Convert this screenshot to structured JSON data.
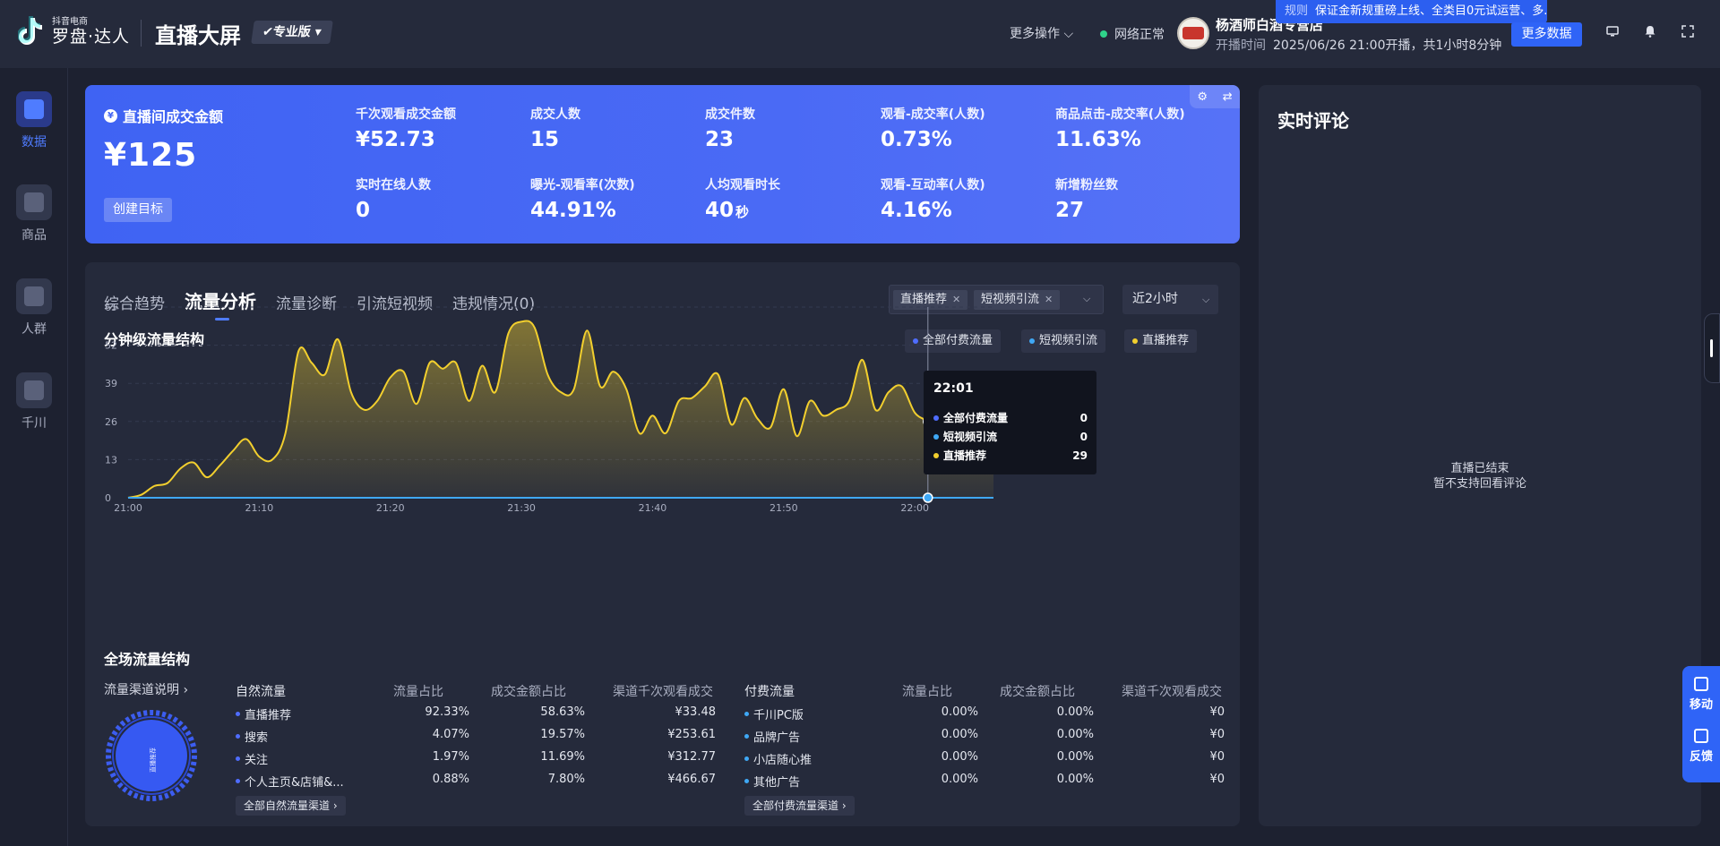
{
  "header": {
    "logo_sub": "抖音电商",
    "logo_main": "罗盘·达人",
    "page_title": "直播大屏",
    "edition": "✔专业版 ▾",
    "more_ops": "更多操作 ⌵",
    "net_status": "网络正常",
    "shop_name": "杨酒师白酒专营店",
    "live_time_label": "开播时间",
    "live_time_value": "2025/06/26 21:00开播，共1小时8分钟",
    "notice_tag": "规则",
    "notice_text": "保证金新规重磅上线、全类目0元试运营、多...",
    "more_data": "更多数据"
  },
  "nav": [
    {
      "label": "数据",
      "active": true
    },
    {
      "label": "商品",
      "active": false
    },
    {
      "label": "人群",
      "active": false
    },
    {
      "label": "千川",
      "active": false
    }
  ],
  "kpi": {
    "main_label": "直播间成交金额",
    "main_value": "¥125",
    "goal_button": "创建目标",
    "cells": [
      {
        "label": "千次观看成交金额",
        "value": "¥52.73",
        "unit": ""
      },
      {
        "label": "成交人数",
        "value": "15",
        "unit": ""
      },
      {
        "label": "成交件数",
        "value": "23",
        "unit": ""
      },
      {
        "label": "观看-成交率(人数)",
        "value": "0.73%",
        "unit": ""
      },
      {
        "label": "商品点击-成交率(人数)",
        "value": "11.63%",
        "unit": ""
      },
      {
        "label": "实时在线人数",
        "value": "0",
        "unit": ""
      },
      {
        "label": "曝光-观看率(次数)",
        "value": "44.91%",
        "unit": ""
      },
      {
        "label": "人均观看时长",
        "value": "40",
        "unit": "秒"
      },
      {
        "label": "观看-互动率(人数)",
        "value": "4.16%",
        "unit": ""
      },
      {
        "label": "新增粉丝数",
        "value": "27",
        "unit": ""
      }
    ]
  },
  "tabs": [
    "综合趋势",
    "流量分析",
    "流量诊断",
    "引流短视频",
    "违规情况(0)"
  ],
  "filters": {
    "chips": [
      "直播推荐",
      "短视频引流"
    ],
    "time_range": "近2小时"
  },
  "chart_section_title": "分钟级流量结构",
  "legend": [
    {
      "name": "全部付费流量",
      "color": "#4f6dff"
    },
    {
      "name": "短视频引流",
      "color": "#3fa8f5"
    },
    {
      "name": "直播推荐",
      "color": "#f2cf2e"
    }
  ],
  "tooltip": {
    "time": "22:01",
    "rows": [
      {
        "name": "全部付费流量",
        "value": "0",
        "color": "#4f6dff"
      },
      {
        "name": "短视频引流",
        "value": "0",
        "color": "#3fa8f5"
      },
      {
        "name": "直播推荐",
        "value": "29",
        "color": "#f2cf2e"
      }
    ]
  },
  "chart_data": {
    "type": "area",
    "title": "分钟级流量结构",
    "xlabel": "",
    "ylabel": "",
    "ylim": [
      0,
      65
    ],
    "yticks": [
      0,
      13,
      26,
      39,
      52,
      65
    ],
    "xticks": [
      "21:00",
      "21:10",
      "21:20",
      "21:30",
      "21:40",
      "21:50",
      "22:00"
    ],
    "x": [
      "21:00",
      "21:01",
      "21:02",
      "21:03",
      "21:04",
      "21:05",
      "21:06",
      "21:07",
      "21:08",
      "21:09",
      "21:10",
      "21:11",
      "21:12",
      "21:13",
      "21:14",
      "21:15",
      "21:16",
      "21:17",
      "21:18",
      "21:19",
      "21:20",
      "21:21",
      "21:22",
      "21:23",
      "21:24",
      "21:25",
      "21:26",
      "21:27",
      "21:28",
      "21:29",
      "21:30",
      "21:31",
      "21:32",
      "21:33",
      "21:34",
      "21:35",
      "21:36",
      "21:37",
      "21:38",
      "21:39",
      "21:40",
      "21:41",
      "21:42",
      "21:43",
      "21:44",
      "21:45",
      "21:46",
      "21:47",
      "21:48",
      "21:49",
      "21:50",
      "21:51",
      "21:52",
      "21:53",
      "21:54",
      "21:55",
      "21:56",
      "21:57",
      "21:58",
      "21:59",
      "22:00",
      "22:01",
      "22:02",
      "22:03",
      "22:04",
      "22:05",
      "22:06",
      "22:07",
      "22:08"
    ],
    "series": [
      {
        "name": "直播推荐",
        "color": "#f2cf2e",
        "values": [
          0,
          1,
          4,
          5,
          10,
          12,
          7,
          11,
          16,
          20,
          14,
          13,
          22,
          50,
          46,
          42,
          54,
          36,
          30,
          33,
          41,
          43,
          32,
          46,
          44,
          46,
          33,
          45,
          36,
          56,
          60,
          58,
          42,
          36,
          37,
          57,
          38,
          43,
          37,
          22,
          28,
          22,
          33,
          34,
          38,
          42,
          25,
          34,
          27,
          24,
          37,
          21,
          33,
          28,
          30,
          33,
          47,
          30,
          36,
          38,
          29,
          26,
          22,
          26,
          14,
          28,
          19,
          0,
          0
        ]
      },
      {
        "name": "短视频引流",
        "color": "#3fa8f5",
        "values": [
          0,
          0,
          0,
          0,
          0,
          0,
          0,
          0,
          0,
          0,
          0,
          0,
          0,
          0,
          0,
          0,
          0,
          0,
          0,
          0,
          0,
          0,
          0,
          0,
          0,
          0,
          0,
          0,
          0,
          0,
          0,
          0,
          0,
          0,
          0,
          0,
          0,
          0,
          0,
          0,
          0,
          0,
          0,
          0,
          0,
          0,
          0,
          0,
          0,
          0,
          0,
          0,
          0,
          0,
          0,
          0,
          0,
          0,
          0,
          0,
          0,
          0,
          0,
          0,
          0,
          0,
          0,
          0,
          0
        ]
      },
      {
        "name": "全部付费流量",
        "color": "#4f6dff",
        "values": [
          0,
          0,
          0,
          0,
          0,
          0,
          0,
          0,
          0,
          0,
          0,
          0,
          0,
          0,
          0,
          0,
          0,
          0,
          0,
          0,
          0,
          0,
          0,
          0,
          0,
          0,
          0,
          0,
          0,
          0,
          0,
          0,
          0,
          0,
          0,
          0,
          0,
          0,
          0,
          0,
          0,
          0,
          0,
          0,
          0,
          0,
          0,
          0,
          0,
          0,
          0,
          0,
          0,
          0,
          0,
          0,
          0,
          0,
          0,
          0,
          0,
          0,
          0,
          0,
          0,
          0,
          0,
          0,
          0
        ]
      }
    ],
    "grid": true,
    "legend_position": "top-right"
  },
  "structure": {
    "title": "全场流量结构",
    "channel_link": "流量渠道说明 ›",
    "donut_label": "直播推荐",
    "natural": {
      "headers": [
        "自然流量",
        "流量占比",
        "成交金额占比",
        "渠道千次观看成交"
      ],
      "rows": [
        {
          "name": "直播推荐",
          "share": "92.33%",
          "gmv_share": "58.63%",
          "gpm": "¥33.48"
        },
        {
          "name": "搜索",
          "share": "4.07%",
          "gmv_share": "19.57%",
          "gpm": "¥253.61"
        },
        {
          "name": "关注",
          "share": "1.97%",
          "gmv_share": "11.69%",
          "gpm": "¥312.77"
        },
        {
          "name": "个人主页&店铺&...",
          "share": "0.88%",
          "gmv_share": "7.80%",
          "gpm": "¥466.67"
        }
      ],
      "all_button": "全部自然流量渠道 ›"
    },
    "paid": {
      "headers": [
        "付费流量",
        "流量占比",
        "成交金额占比",
        "渠道千次观看成交"
      ],
      "rows": [
        {
          "name": "千川PC版",
          "share": "0.00%",
          "gmv_share": "0.00%",
          "gpm": "¥0"
        },
        {
          "name": "品牌广告",
          "share": "0.00%",
          "gmv_share": "0.00%",
          "gpm": "¥0"
        },
        {
          "name": "小店随心推",
          "share": "0.00%",
          "gmv_share": "0.00%",
          "gpm": "¥0"
        },
        {
          "name": "其他广告",
          "share": "0.00%",
          "gmv_share": "0.00%",
          "gpm": "¥0"
        }
      ],
      "all_button": "全部付费流量渠道 ›"
    }
  },
  "comments": {
    "title": "实时评论",
    "empty_line1": "直播已结束",
    "empty_line2": "暂不支持回看评论"
  },
  "float": {
    "move": "移动",
    "feedback": "反馈"
  }
}
